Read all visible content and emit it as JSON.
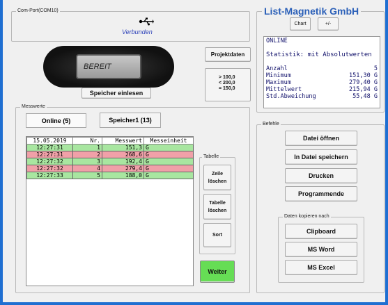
{
  "com_port": {
    "label": "Com-Port(COM10)",
    "status": "Verbunden",
    "icon": "usb-icon"
  },
  "app_title": "List-Magnetik GmbH",
  "top_buttons": {
    "chart": "Chart",
    "plus_minus": "+/-"
  },
  "stats": {
    "mode": "ONLINE",
    "heading": "Statistik:  mit Absolutwerten",
    "rows": [
      {
        "label": "Anzahl",
        "value": "5"
      },
      {
        "label": "Minimum",
        "value": "151,30 G"
      },
      {
        "label": "Maximum",
        "value": "279,40 G"
      },
      {
        "label": "Mittelwert",
        "value": "215,94 G"
      },
      {
        "label": "Std.Abweichung",
        "value": "55,48 G"
      }
    ]
  },
  "device": {
    "display": "BEREIT",
    "read_button": "Speicher einlesen"
  },
  "projekt": {
    "button": "Projektdaten",
    "limits": [
      "> 100,0",
      "< 200,0",
      "= 150,0"
    ]
  },
  "messwerte": {
    "label": "Messwerte",
    "tabs": [
      "Online (5)",
      "Speicher1 (13)"
    ],
    "columns": [
      "15.05.2019",
      "Nr.",
      "Messwert",
      "Messeinheit"
    ],
    "rows": [
      {
        "time": "12:27:31",
        "nr": "1",
        "value": "151,3",
        "unit": "G",
        "status": "ok"
      },
      {
        "time": "12:27:31",
        "nr": "2",
        "value": "268,6",
        "unit": "G",
        "status": "bad"
      },
      {
        "time": "12:27:32",
        "nr": "3",
        "value": "192,4",
        "unit": "G",
        "status": "ok"
      },
      {
        "time": "12:27:32",
        "nr": "4",
        "value": "279,4",
        "unit": "G",
        "status": "bad"
      },
      {
        "time": "12:27:33",
        "nr": "5",
        "value": "188,0",
        "unit": "G",
        "status": "ok"
      }
    ]
  },
  "tabelle": {
    "label": "Tabelle",
    "zeile": "Zeile\nlöschen",
    "tabelle": "Tabelle\nlöschen",
    "sort": "Sort"
  },
  "weiter": "Weiter",
  "befehle": {
    "label": "Befehle",
    "buttons": [
      "Datei öffnen",
      "In Datei speichern",
      "Drucken",
      "Programmende"
    ],
    "kopieren_label": "Daten kopieren nach",
    "kopieren": [
      "Clipboard",
      "MS Word",
      "MS Excel"
    ]
  },
  "colors": {
    "accent": "#1f6fd1",
    "title": "#2a5fb8",
    "ok_row": "#a8e6a0",
    "bad_row": "#f0a0a8",
    "weiter": "#66dd55"
  }
}
